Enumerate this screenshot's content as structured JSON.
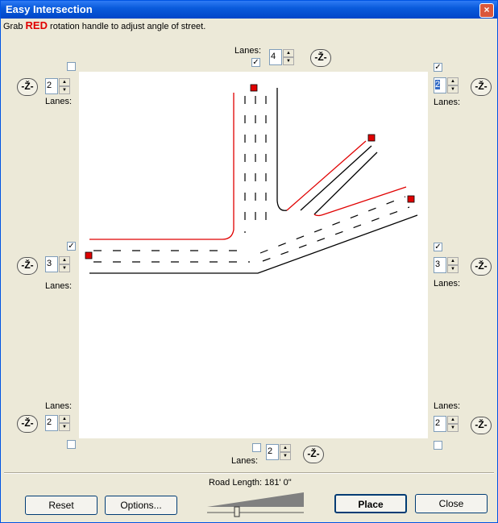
{
  "window": {
    "title": "Easy Intersection",
    "close_glyph": "×"
  },
  "hint": {
    "prefix": "Grab",
    "red": "RED",
    "suffix": "rotation handle to adjust angle of street."
  },
  "streets": {
    "top": {
      "label": "Lanes:",
      "value": "4",
      "checked": true
    },
    "left_top": {
      "label": "Lanes:",
      "value": "2",
      "checked": false
    },
    "left_mid": {
      "label": "Lanes:",
      "value": "3",
      "checked": true
    },
    "left_bot": {
      "label": "Lanes:",
      "value": "2",
      "checked": false
    },
    "right_top": {
      "label": "Lanes:",
      "value": "2",
      "checked": true
    },
    "right_mid": {
      "label": "Lanes:",
      "value": "3",
      "checked": true
    },
    "right_bot": {
      "label": "Lanes:",
      "value": "2",
      "checked": false
    },
    "bottom": {
      "label": "Lanes:",
      "value": "2",
      "checked": false
    }
  },
  "check_glyph": "✓",
  "spin_glyphs": {
    "up": "▲",
    "down": "▼"
  },
  "rotate_glyph": "-Ž-",
  "footer": {
    "road_length_label": "Road Length: 181' 0\"",
    "reset": "Reset",
    "options": "Options...",
    "place": "Place",
    "close": "Close",
    "road_length_fraction": 0.3
  },
  "colors": {
    "handle": "#e00000",
    "red_edge": "#e00000",
    "edge": "#000000"
  }
}
